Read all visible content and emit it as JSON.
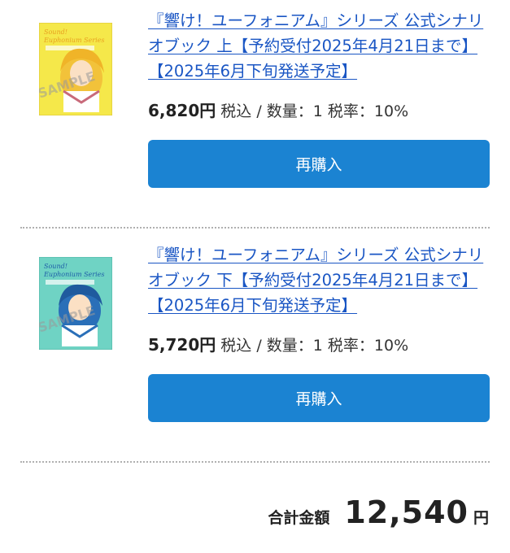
{
  "items": [
    {
      "title": "『響け！ユーフォニアム』シリーズ 公式シナリオブック 上【予約受付2025年4月21日まで】【2025年6月下旬発送予定】",
      "price": "6,820円",
      "details": " 税込 / 数量：1 税率：10%",
      "button_label": "再購入",
      "cover": {
        "bg_color": "#f5e84a",
        "series_text": "Sound! Euphonium Series",
        "sample_text": "SAMPLE",
        "accent_color": "#e8a020"
      }
    },
    {
      "title": "『響け！ユーフォニアム』シリーズ 公式シナリオブック 下【予約受付2025年4月21日まで】【2025年6月下旬発送予定】",
      "price": "5,720円",
      "details": " 税込 / 数量：1 税率：10%",
      "button_label": "再購入",
      "cover": {
        "bg_color": "#6fd3c4",
        "series_text": "Sound! Euphonium Series",
        "sample_text": "SAMPLE",
        "accent_color": "#2a6fb8"
      }
    }
  ],
  "total": {
    "label": "合計金額",
    "amount": "12,540",
    "unit": "円"
  },
  "colors": {
    "link": "#1a56c4",
    "button": "#1b83d2"
  }
}
